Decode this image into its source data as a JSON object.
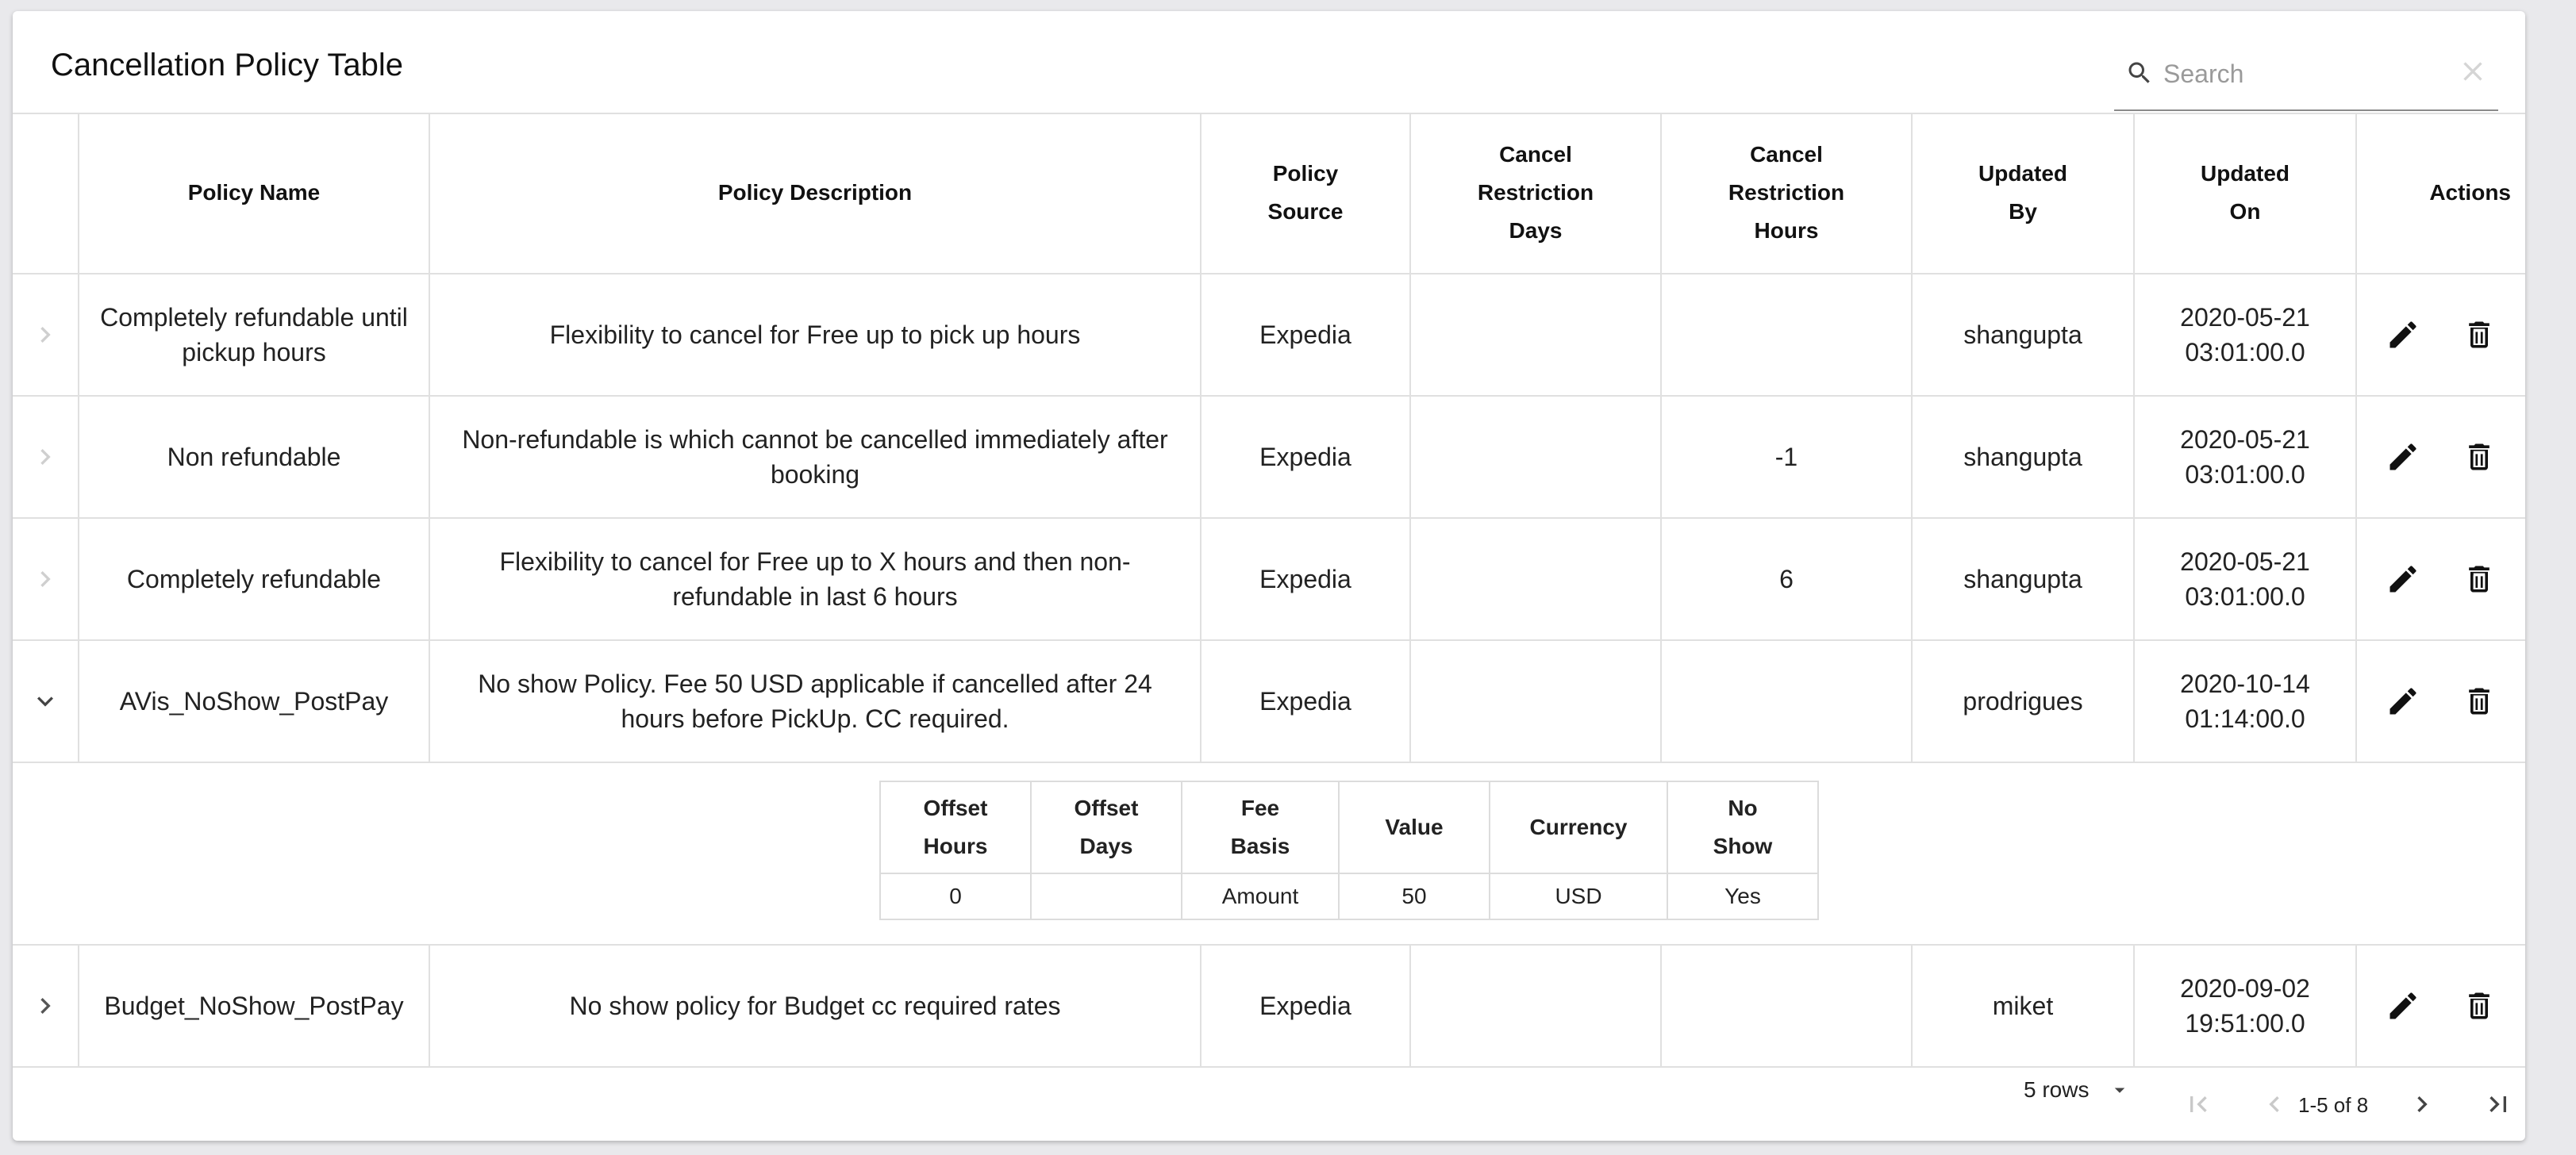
{
  "title": "Cancellation Policy Table",
  "search": {
    "placeholder": "Search",
    "value": ""
  },
  "columns": {
    "policy_name": "Policy Name",
    "policy_description": "Policy Description",
    "policy_source_1": "Policy",
    "policy_source_2": "Source",
    "cancel_days_1": "Cancel",
    "cancel_days_2": "Restriction",
    "cancel_days_3": "Days",
    "cancel_hours_1": "Cancel",
    "cancel_hours_2": "Restriction",
    "cancel_hours_3": "Hours",
    "updated_by_1": "Updated",
    "updated_by_2": "By",
    "updated_on_1": "Updated",
    "updated_on_2": "On",
    "actions": "Actions"
  },
  "rows": [
    {
      "expanded": false,
      "name": "Completely refundable until pickup hours",
      "description": "Flexibility to cancel for Free up to pick up hours",
      "source": "Expedia",
      "days": "",
      "hours": "",
      "updated_by": "shangupta",
      "updated_on_1": "2020-05-21",
      "updated_on_2": "03:01:00.0"
    },
    {
      "expanded": false,
      "name": "Non refundable",
      "description": "Non-refundable is which cannot be cancelled immediately after booking",
      "source": "Expedia",
      "days": "",
      "hours": "-1",
      "updated_by": "shangupta",
      "updated_on_1": "2020-05-21",
      "updated_on_2": "03:01:00.0"
    },
    {
      "expanded": false,
      "name": "Completely refundable",
      "description": "Flexibility to cancel for Free up to X hours and then non-refundable in last 6 hours",
      "source": "Expedia",
      "days": "",
      "hours": "6",
      "updated_by": "shangupta",
      "updated_on_1": "2020-05-21",
      "updated_on_2": "03:01:00.0"
    },
    {
      "expanded": true,
      "name": "AVis_NoShow_PostPay",
      "description": "No show Policy. Fee 50 USD applicable if cancelled after 24 hours before PickUp. CC required.",
      "source": "Expedia",
      "days": "",
      "hours": "",
      "updated_by": "prodrigues",
      "updated_on_1": "2020-10-14",
      "updated_on_2": "01:14:00.0"
    },
    {
      "expanded": false,
      "name": "Budget_NoShow_PostPay",
      "description": "No show policy for Budget cc required rates",
      "source": "Expedia",
      "days": "",
      "hours": "",
      "updated_by": "miket",
      "updated_on_1": "2020-09-02",
      "updated_on_2": "19:51:00.0"
    }
  ],
  "detail": {
    "headers": [
      {
        "l1": "Offset",
        "l2": "Hours"
      },
      {
        "l1": "Offset",
        "l2": "Days"
      },
      {
        "l1": "Fee",
        "l2": "Basis"
      },
      {
        "l1": "Value",
        "l2": ""
      },
      {
        "l1": "Currency",
        "l2": ""
      },
      {
        "l1": "No",
        "l2": "Show"
      }
    ],
    "values": [
      "0",
      "",
      "Amount",
      "50",
      "USD",
      "Yes"
    ]
  },
  "pagination": {
    "rows_label": "5 rows",
    "range_label": "1-5 of 8"
  },
  "icons": {
    "search": "search-icon",
    "clear": "close-icon",
    "expand": "chevron-right-icon",
    "collapse": "chevron-down-icon",
    "edit": "pencil-icon",
    "delete": "trash-icon",
    "first": "first-page-icon",
    "prev": "chevron-left-icon",
    "next": "chevron-right-icon",
    "last": "last-page-icon"
  }
}
